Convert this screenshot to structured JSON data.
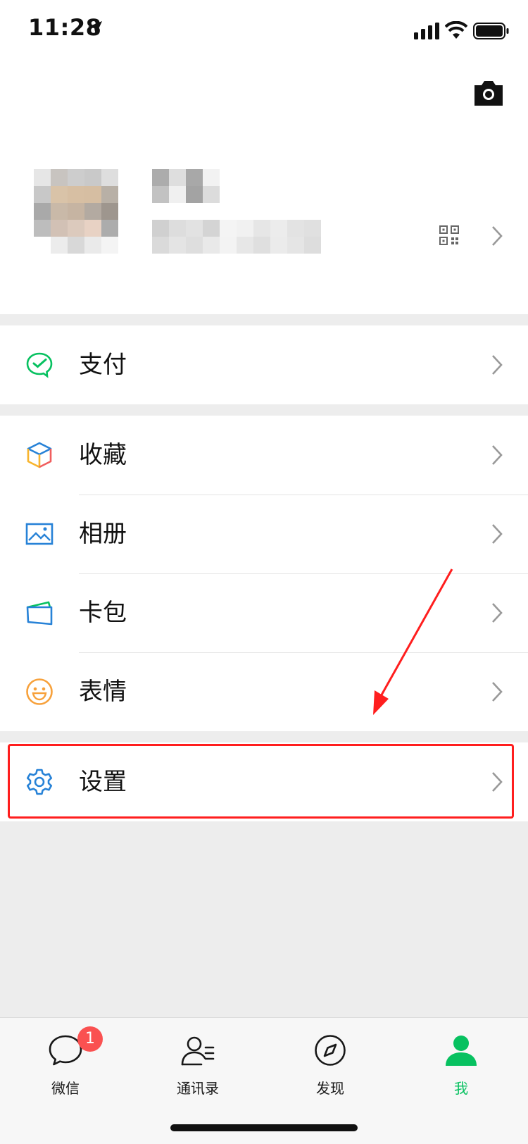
{
  "status_bar": {
    "time": "11:28"
  },
  "menu": {
    "pay": {
      "label": "支付",
      "icon": "wechat-pay-icon"
    },
    "favorites": {
      "label": "收藏",
      "icon": "favorites-cube-icon"
    },
    "album": {
      "label": "相册",
      "icon": "album-icon"
    },
    "cards": {
      "label": "卡包",
      "icon": "card-wallet-icon"
    },
    "stickers": {
      "label": "表情",
      "icon": "smiley-icon"
    },
    "settings": {
      "label": "设置",
      "icon": "gear-icon"
    }
  },
  "tab_bar": {
    "tabs": [
      {
        "label": "微信",
        "icon": "chat-bubble-icon",
        "badge": "1"
      },
      {
        "label": "通讯录",
        "icon": "contacts-icon"
      },
      {
        "label": "发现",
        "icon": "compass-icon"
      },
      {
        "label": "我",
        "icon": "person-icon",
        "active": true
      }
    ]
  },
  "colors": {
    "accent_green": "#07c160",
    "badge_red": "#fa5151",
    "highlight_red": "#ff1e1e",
    "icon_blue": "#2782d7",
    "background": "#ededed"
  }
}
